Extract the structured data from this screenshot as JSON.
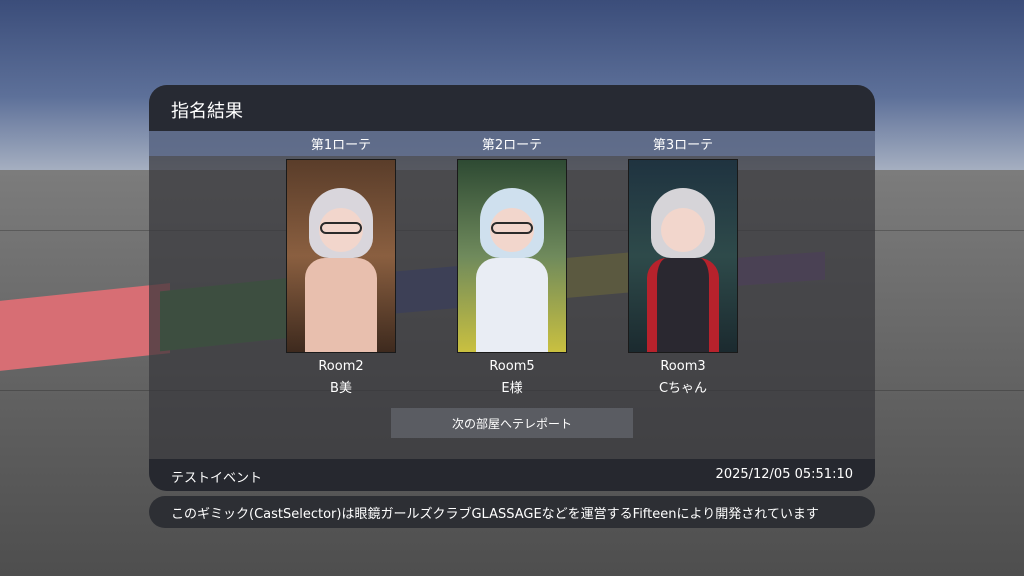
{
  "panel": {
    "title": "指名結果"
  },
  "slots": [
    {
      "rote": "第1ローテ",
      "room": "Room2",
      "name": "B美"
    },
    {
      "rote": "第2ローテ",
      "room": "Room5",
      "name": "E様"
    },
    {
      "rote": "第3ローテ",
      "room": "Room3",
      "name": "Cちゃん"
    }
  ],
  "teleport_button": {
    "label": "次の部屋へテレポート"
  },
  "footer": {
    "event_name": "テストイベント",
    "datetime": "2025/12/05 05:51:10"
  },
  "credit": {
    "text": "このギミック(CastSelector)は眼鏡ガールズクラブGLASSAGEなどを運営するFifteenにより開発されています"
  },
  "colors": {
    "header_bg": "#272a33",
    "band_bg": "#6e82af",
    "button_bg": "#5a5c62"
  }
}
